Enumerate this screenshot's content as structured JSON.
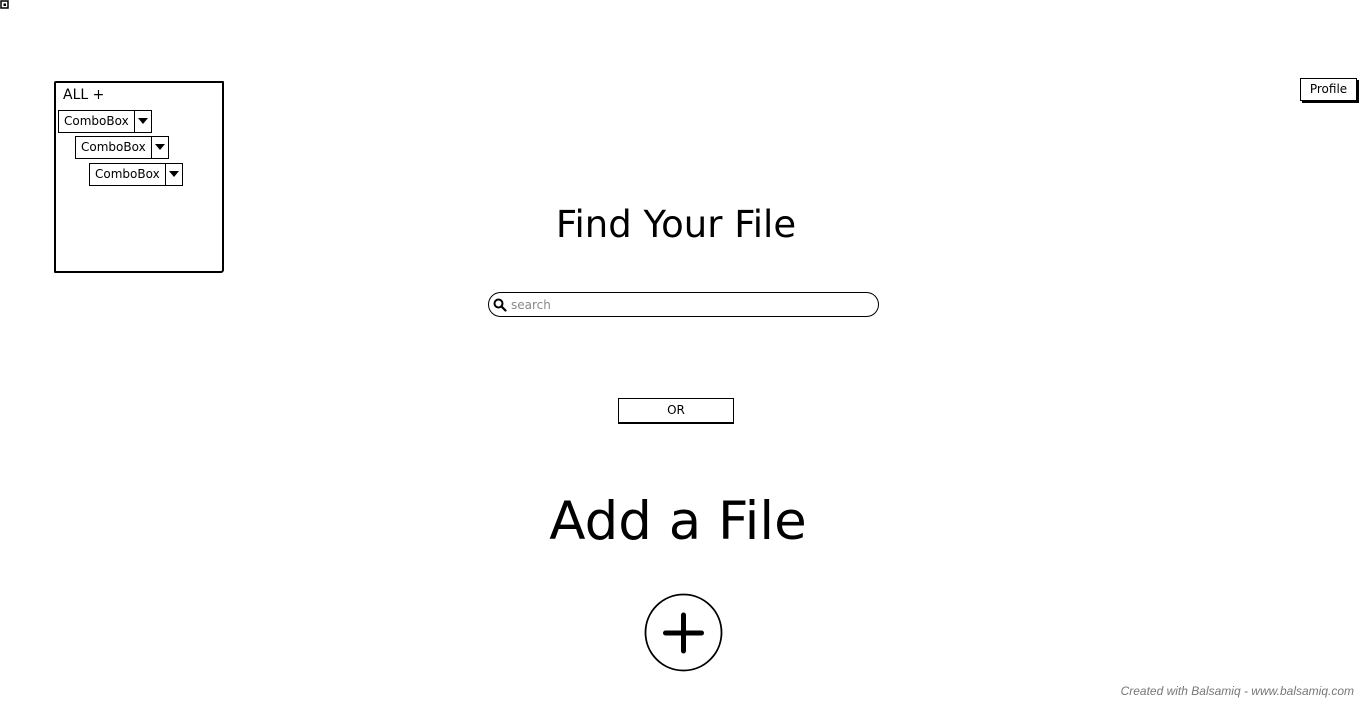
{
  "filter_panel": {
    "title": "ALL +",
    "combos": [
      {
        "value": "ComboBox"
      },
      {
        "value": "ComboBox"
      },
      {
        "value": "ComboBox"
      }
    ]
  },
  "header": {
    "profile_label": "Profile"
  },
  "search_section": {
    "title": "Find Your File",
    "placeholder": "search"
  },
  "divider": {
    "or_label": "OR"
  },
  "add_section": {
    "title": "Add a File"
  },
  "footer": {
    "credit": "Created with Balsamiq - www.balsamiq.com"
  },
  "icons": {
    "corner": "app-icon",
    "search": "search-icon",
    "dropdown": "chevron-down-icon",
    "add": "plus-circle-icon"
  }
}
